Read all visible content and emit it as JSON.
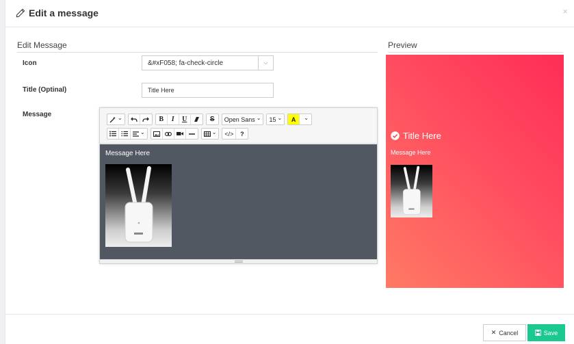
{
  "modal": {
    "title": "Edit a message",
    "close_glyph": "×",
    "title_icon": "pencil-icon"
  },
  "edit": {
    "section_title": "Edit Message",
    "icon_label": "Icon",
    "icon_value": "&#xF058; fa-check-circle",
    "title_label": "Title (Optinal)",
    "title_value": "Title Here",
    "message_label": "Message"
  },
  "toolbar": {
    "row1": [
      "magic-icon",
      "undo-icon",
      "redo-icon",
      "B",
      "I",
      "U",
      "eraser-icon",
      "S",
      "Open Sans",
      "15",
      "A",
      "color-caret"
    ],
    "font_name": "Open Sans",
    "font_size": "15",
    "highlight_letter": "A",
    "help": "?",
    "code": "</>"
  },
  "editor": {
    "message_text": "Message Here"
  },
  "preview": {
    "section_title": "Preview",
    "title": "Title Here",
    "message": "Message Here",
    "icon": "check-circle-icon",
    "gradient": [
      "#ff2d55",
      "#ff7a64"
    ]
  },
  "footer": {
    "cancel_label": "Cancel",
    "save_label": "Save",
    "save_color": "#1bc990"
  }
}
